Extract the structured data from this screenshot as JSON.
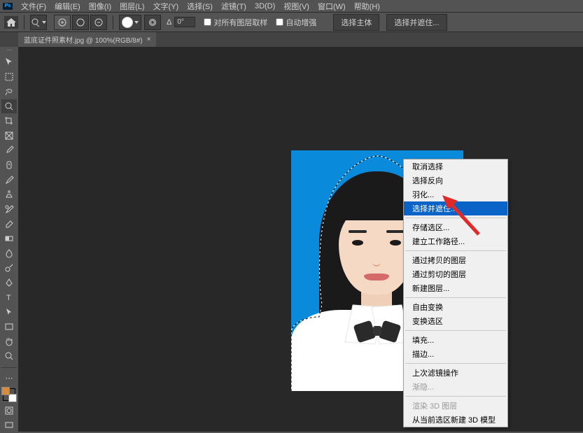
{
  "menu": {
    "items": [
      "文件(F)",
      "编辑(E)",
      "图像(I)",
      "图层(L)",
      "文字(Y)",
      "选择(S)",
      "滤镜(T)",
      "3D(D)",
      "视图(V)",
      "窗口(W)",
      "帮助(H)"
    ]
  },
  "options": {
    "angle_label": "Δ",
    "angle_value": "0°",
    "sample_all_label": "对所有图层取样",
    "auto_enhance_label": "自动增强",
    "select_subject_label": "选择主体",
    "select_and_mask_label": "选择并遮住..."
  },
  "tab": {
    "title": "蓝底证件照素材.jpg @ 100%(RGB/8#)",
    "close": "×"
  },
  "tools": {
    "names": [
      "move-tool",
      "rect-marquee-tool",
      "lasso-tool",
      "quick-select-tool",
      "crop-tool",
      "frame-tool",
      "eyedropper-tool",
      "healing-brush-tool",
      "brush-tool",
      "clone-stamp-tool",
      "history-brush-tool",
      "eraser-tool",
      "gradient-tool",
      "blur-tool",
      "dodge-tool",
      "pen-tool",
      "type-tool",
      "path-select-tool",
      "rectangle-tool",
      "hand-tool",
      "zoom-tool"
    ]
  },
  "context_menu": {
    "items": [
      {
        "label": "取消选择",
        "enabled": true
      },
      {
        "label": "选择反向",
        "enabled": true
      },
      {
        "label": "羽化...",
        "enabled": true
      },
      {
        "label": "选择并遮住...",
        "enabled": true,
        "highlight": true
      },
      {
        "sep": true
      },
      {
        "label": "存储选区...",
        "enabled": true
      },
      {
        "label": "建立工作路径...",
        "enabled": true
      },
      {
        "sep": true
      },
      {
        "label": "通过拷贝的图层",
        "enabled": true
      },
      {
        "label": "通过剪切的图层",
        "enabled": true
      },
      {
        "label": "新建图层...",
        "enabled": true
      },
      {
        "sep": true
      },
      {
        "label": "自由变换",
        "enabled": true
      },
      {
        "label": "变换选区",
        "enabled": true
      },
      {
        "sep": true
      },
      {
        "label": "填充...",
        "enabled": true
      },
      {
        "label": "描边...",
        "enabled": true
      },
      {
        "sep": true
      },
      {
        "label": "上次滤镜操作",
        "enabled": true
      },
      {
        "label": "渐隐...",
        "enabled": false
      },
      {
        "sep": true
      },
      {
        "label": "渲染 3D 图层",
        "enabled": false
      },
      {
        "label": "从当前选区新建 3D 模型",
        "enabled": true
      }
    ]
  }
}
